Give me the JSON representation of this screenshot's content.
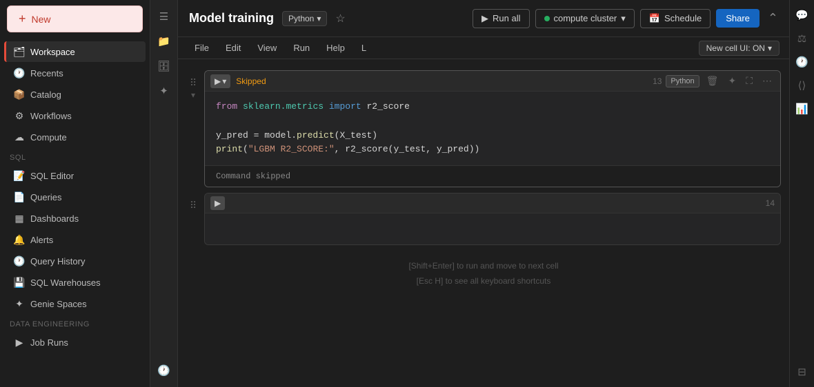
{
  "sidebar": {
    "new_label": "New",
    "items": [
      {
        "id": "workspace",
        "label": "Workspace",
        "icon": "🗂",
        "active": true
      },
      {
        "id": "recents",
        "label": "Recents",
        "icon": "🕐",
        "active": false
      },
      {
        "id": "catalog",
        "label": "Catalog",
        "icon": "📦",
        "active": false
      },
      {
        "id": "workflows",
        "label": "Workflows",
        "icon": "⚙",
        "active": false
      },
      {
        "id": "compute",
        "label": "Compute",
        "icon": "☁",
        "active": false
      }
    ],
    "sql_section": "SQL",
    "sql_items": [
      {
        "id": "sql-editor",
        "label": "SQL Editor",
        "icon": "📝"
      },
      {
        "id": "queries",
        "label": "Queries",
        "icon": "📄"
      },
      {
        "id": "dashboards",
        "label": "Dashboards",
        "icon": "▦"
      },
      {
        "id": "alerts",
        "label": "Alerts",
        "icon": "🔔"
      },
      {
        "id": "query-history",
        "label": "Query History",
        "icon": "🕐"
      },
      {
        "id": "sql-warehouses",
        "label": "SQL Warehouses",
        "icon": "💾"
      },
      {
        "id": "genie-spaces",
        "label": "Genie Spaces",
        "icon": "✦"
      }
    ],
    "data_engineering_section": "Data Engineering",
    "data_engineering_items": [
      {
        "id": "job-runs",
        "label": "Job Runs",
        "icon": "▶"
      }
    ]
  },
  "topbar": {
    "title": "Model training",
    "language": "Python",
    "run_all_label": "Run all",
    "compute_label": "compute cluster",
    "schedule_label": "Schedule",
    "share_label": "Share"
  },
  "menubar": {
    "items": [
      "File",
      "Edit",
      "View",
      "Run",
      "Help",
      "L"
    ],
    "cell_ui_toggle": "New cell UI: ON"
  },
  "cells": [
    {
      "id": "cell-13",
      "num": "13",
      "status": "Skipped",
      "lang": "Python",
      "lines": [
        {
          "type": "code",
          "content": "from sklearn.metrics import r2_score"
        },
        {
          "type": "empty"
        },
        {
          "type": "code",
          "content": "y_pred = model.predict(X_test)"
        },
        {
          "type": "code",
          "content": "print(\"LGBM R2_SCORE:\", r2_score(y_test, y_pred))"
        }
      ],
      "output": "Command skipped"
    },
    {
      "id": "cell-14",
      "num": "14",
      "status": "",
      "lang": "",
      "lines": [],
      "output": ""
    }
  ],
  "hints": {
    "line1": "[Shift+Enter] to run and move to next cell",
    "line2": "[Esc H] to see all keyboard shortcuts"
  },
  "right_strip": {
    "icons": [
      "💬",
      "⚖",
      "🕐",
      "⟨⟩",
      "📊",
      "⊟"
    ]
  }
}
